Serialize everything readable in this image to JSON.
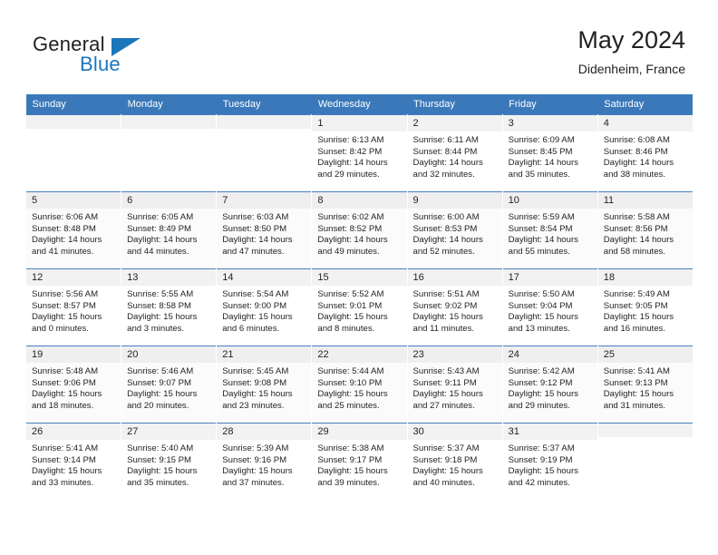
{
  "brand": {
    "word_one": "General",
    "word_two": "Blue",
    "triangle_icon": "triangle-icon",
    "accent_color": "#1b75bb"
  },
  "header": {
    "title": "May 2024",
    "subtitle": "Didenheim, France"
  },
  "theme": {
    "header_row_background": "#3a78ba",
    "header_row_text": "#ffffff",
    "daynum_background": "#f2f2f2",
    "row_border": "#4a7ebb"
  },
  "weekdays": [
    "Sunday",
    "Monday",
    "Tuesday",
    "Wednesday",
    "Thursday",
    "Friday",
    "Saturday"
  ],
  "weeks": [
    {
      "shaded": false,
      "days": [
        {
          "empty": true
        },
        {
          "empty": true
        },
        {
          "empty": true
        },
        {
          "day": "1",
          "sunrise": "Sunrise: 6:13 AM",
          "sunset": "Sunset: 8:42 PM",
          "daylight_line1": "Daylight: 14 hours",
          "daylight_line2": "and 29 minutes."
        },
        {
          "day": "2",
          "sunrise": "Sunrise: 6:11 AM",
          "sunset": "Sunset: 8:44 PM",
          "daylight_line1": "Daylight: 14 hours",
          "daylight_line2": "and 32 minutes."
        },
        {
          "day": "3",
          "sunrise": "Sunrise: 6:09 AM",
          "sunset": "Sunset: 8:45 PM",
          "daylight_line1": "Daylight: 14 hours",
          "daylight_line2": "and 35 minutes."
        },
        {
          "day": "4",
          "sunrise": "Sunrise: 6:08 AM",
          "sunset": "Sunset: 8:46 PM",
          "daylight_line1": "Daylight: 14 hours",
          "daylight_line2": "and 38 minutes."
        }
      ]
    },
    {
      "shaded": true,
      "days": [
        {
          "day": "5",
          "sunrise": "Sunrise: 6:06 AM",
          "sunset": "Sunset: 8:48 PM",
          "daylight_line1": "Daylight: 14 hours",
          "daylight_line2": "and 41 minutes."
        },
        {
          "day": "6",
          "sunrise": "Sunrise: 6:05 AM",
          "sunset": "Sunset: 8:49 PM",
          "daylight_line1": "Daylight: 14 hours",
          "daylight_line2": "and 44 minutes."
        },
        {
          "day": "7",
          "sunrise": "Sunrise: 6:03 AM",
          "sunset": "Sunset: 8:50 PM",
          "daylight_line1": "Daylight: 14 hours",
          "daylight_line2": "and 47 minutes."
        },
        {
          "day": "8",
          "sunrise": "Sunrise: 6:02 AM",
          "sunset": "Sunset: 8:52 PM",
          "daylight_line1": "Daylight: 14 hours",
          "daylight_line2": "and 49 minutes."
        },
        {
          "day": "9",
          "sunrise": "Sunrise: 6:00 AM",
          "sunset": "Sunset: 8:53 PM",
          "daylight_line1": "Daylight: 14 hours",
          "daylight_line2": "and 52 minutes."
        },
        {
          "day": "10",
          "sunrise": "Sunrise: 5:59 AM",
          "sunset": "Sunset: 8:54 PM",
          "daylight_line1": "Daylight: 14 hours",
          "daylight_line2": "and 55 minutes."
        },
        {
          "day": "11",
          "sunrise": "Sunrise: 5:58 AM",
          "sunset": "Sunset: 8:56 PM",
          "daylight_line1": "Daylight: 14 hours",
          "daylight_line2": "and 58 minutes."
        }
      ]
    },
    {
      "shaded": false,
      "days": [
        {
          "day": "12",
          "sunrise": "Sunrise: 5:56 AM",
          "sunset": "Sunset: 8:57 PM",
          "daylight_line1": "Daylight: 15 hours",
          "daylight_line2": "and 0 minutes."
        },
        {
          "day": "13",
          "sunrise": "Sunrise: 5:55 AM",
          "sunset": "Sunset: 8:58 PM",
          "daylight_line1": "Daylight: 15 hours",
          "daylight_line2": "and 3 minutes."
        },
        {
          "day": "14",
          "sunrise": "Sunrise: 5:54 AM",
          "sunset": "Sunset: 9:00 PM",
          "daylight_line1": "Daylight: 15 hours",
          "daylight_line2": "and 6 minutes."
        },
        {
          "day": "15",
          "sunrise": "Sunrise: 5:52 AM",
          "sunset": "Sunset: 9:01 PM",
          "daylight_line1": "Daylight: 15 hours",
          "daylight_line2": "and 8 minutes."
        },
        {
          "day": "16",
          "sunrise": "Sunrise: 5:51 AM",
          "sunset": "Sunset: 9:02 PM",
          "daylight_line1": "Daylight: 15 hours",
          "daylight_line2": "and 11 minutes."
        },
        {
          "day": "17",
          "sunrise": "Sunrise: 5:50 AM",
          "sunset": "Sunset: 9:04 PM",
          "daylight_line1": "Daylight: 15 hours",
          "daylight_line2": "and 13 minutes."
        },
        {
          "day": "18",
          "sunrise": "Sunrise: 5:49 AM",
          "sunset": "Sunset: 9:05 PM",
          "daylight_line1": "Daylight: 15 hours",
          "daylight_line2": "and 16 minutes."
        }
      ]
    },
    {
      "shaded": true,
      "days": [
        {
          "day": "19",
          "sunrise": "Sunrise: 5:48 AM",
          "sunset": "Sunset: 9:06 PM",
          "daylight_line1": "Daylight: 15 hours",
          "daylight_line2": "and 18 minutes."
        },
        {
          "day": "20",
          "sunrise": "Sunrise: 5:46 AM",
          "sunset": "Sunset: 9:07 PM",
          "daylight_line1": "Daylight: 15 hours",
          "daylight_line2": "and 20 minutes."
        },
        {
          "day": "21",
          "sunrise": "Sunrise: 5:45 AM",
          "sunset": "Sunset: 9:08 PM",
          "daylight_line1": "Daylight: 15 hours",
          "daylight_line2": "and 23 minutes."
        },
        {
          "day": "22",
          "sunrise": "Sunrise: 5:44 AM",
          "sunset": "Sunset: 9:10 PM",
          "daylight_line1": "Daylight: 15 hours",
          "daylight_line2": "and 25 minutes."
        },
        {
          "day": "23",
          "sunrise": "Sunrise: 5:43 AM",
          "sunset": "Sunset: 9:11 PM",
          "daylight_line1": "Daylight: 15 hours",
          "daylight_line2": "and 27 minutes."
        },
        {
          "day": "24",
          "sunrise": "Sunrise: 5:42 AM",
          "sunset": "Sunset: 9:12 PM",
          "daylight_line1": "Daylight: 15 hours",
          "daylight_line2": "and 29 minutes."
        },
        {
          "day": "25",
          "sunrise": "Sunrise: 5:41 AM",
          "sunset": "Sunset: 9:13 PM",
          "daylight_line1": "Daylight: 15 hours",
          "daylight_line2": "and 31 minutes."
        }
      ]
    },
    {
      "shaded": false,
      "days": [
        {
          "day": "26",
          "sunrise": "Sunrise: 5:41 AM",
          "sunset": "Sunset: 9:14 PM",
          "daylight_line1": "Daylight: 15 hours",
          "daylight_line2": "and 33 minutes."
        },
        {
          "day": "27",
          "sunrise": "Sunrise: 5:40 AM",
          "sunset": "Sunset: 9:15 PM",
          "daylight_line1": "Daylight: 15 hours",
          "daylight_line2": "and 35 minutes."
        },
        {
          "day": "28",
          "sunrise": "Sunrise: 5:39 AM",
          "sunset": "Sunset: 9:16 PM",
          "daylight_line1": "Daylight: 15 hours",
          "daylight_line2": "and 37 minutes."
        },
        {
          "day": "29",
          "sunrise": "Sunrise: 5:38 AM",
          "sunset": "Sunset: 9:17 PM",
          "daylight_line1": "Daylight: 15 hours",
          "daylight_line2": "and 39 minutes."
        },
        {
          "day": "30",
          "sunrise": "Sunrise: 5:37 AM",
          "sunset": "Sunset: 9:18 PM",
          "daylight_line1": "Daylight: 15 hours",
          "daylight_line2": "and 40 minutes."
        },
        {
          "day": "31",
          "sunrise": "Sunrise: 5:37 AM",
          "sunset": "Sunset: 9:19 PM",
          "daylight_line1": "Daylight: 15 hours",
          "daylight_line2": "and 42 minutes."
        },
        {
          "empty": true
        }
      ]
    }
  ]
}
